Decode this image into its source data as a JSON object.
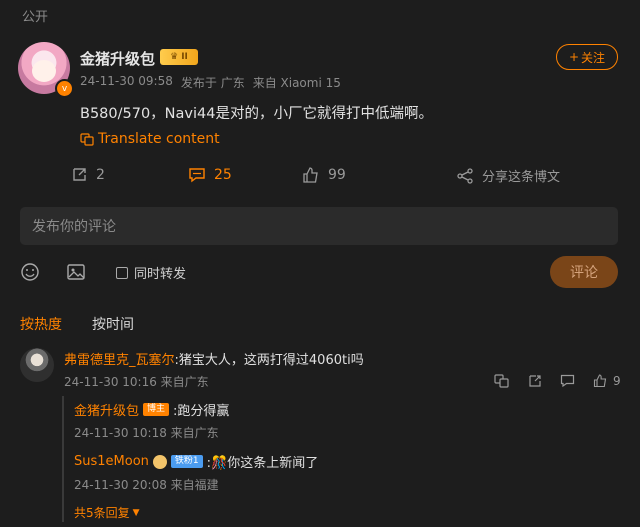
{
  "visibility": "公开",
  "post": {
    "author": "金猪升级包",
    "level_badge": "II",
    "verified_badge": "v",
    "timestamp": "24-11-30 09:58",
    "published_from": "发布于 广东",
    "device": "来自 Xiaomi 15",
    "follow_label": "关注",
    "text": "B580/570，Navi44是对的，小厂它就得打中低端啊。",
    "translate_label": "Translate content",
    "reposts": "2",
    "comments": "25",
    "likes": "99",
    "share_label": "分享这条博文"
  },
  "composer": {
    "placeholder": "发布你的评论",
    "repost_checkbox_label": "同时转发",
    "submit_label": "评论"
  },
  "sort_tabs": {
    "hot": "按热度",
    "time": "按时间"
  },
  "comment": {
    "author": "弗雷德里克_瓦塞尔",
    "text": ":猪宝大人，这两打得过4060ti吗",
    "meta": "24-11-30 10:16 来自广东",
    "likes": "9",
    "replies": [
      {
        "author": "金猪升级包",
        "badge": "博主",
        "text": ":跑分得赢",
        "meta": "24-11-30 10:18 来自广东"
      },
      {
        "author": "Sus1eMoon",
        "badge": "铁粉1",
        "text": ":🎊你这条上新闻了",
        "meta": "24-11-30 20:08 来自福建"
      }
    ],
    "more_replies": "共5条回复"
  },
  "colors": {
    "accent": "#ff8200",
    "background": "#1d1d1d"
  }
}
